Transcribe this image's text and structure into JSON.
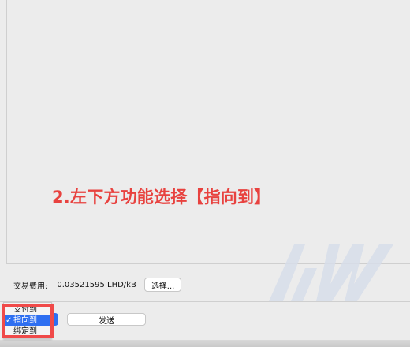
{
  "main": {
    "instruction": "2.左下方功能选择【指向到】"
  },
  "fee": {
    "label": "交易费用:",
    "value": "0.03521595 LHD/kB",
    "choose_button_label": "选择..."
  },
  "footer": {
    "send_label": "发送",
    "dropdown": {
      "options": [
        "支付到",
        "指向到",
        "绑定到"
      ],
      "selected": "指向到"
    }
  },
  "watermark": {
    "name": "aw-watermark-icon",
    "color": "#d8deea"
  },
  "colors": {
    "accent": "#2e6ff1",
    "annotation": "#e8423f",
    "highlight": "#f04a49"
  }
}
